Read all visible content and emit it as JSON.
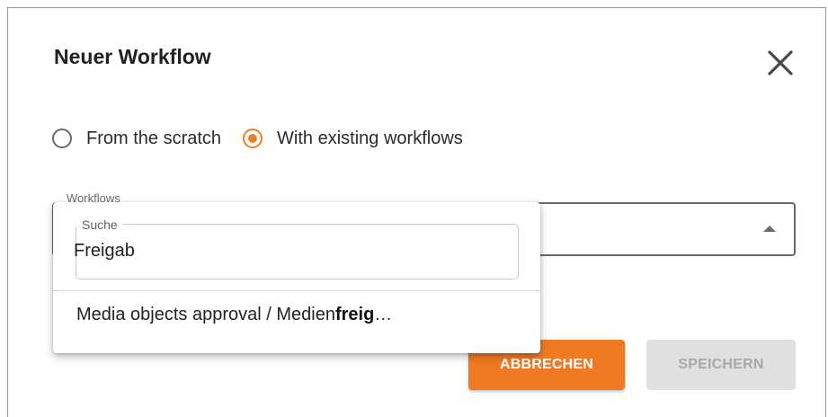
{
  "dialog": {
    "title": "Neuer Workflow",
    "close_icon": "close-icon"
  },
  "mode": {
    "options": [
      {
        "label": "From the scratch",
        "selected": false
      },
      {
        "label": "With existing workflows",
        "selected": true
      }
    ]
  },
  "workflows_field": {
    "label": "Workflows",
    "value": ""
  },
  "dropdown": {
    "search_label": "Suche",
    "search_value": "Freigab",
    "results": [
      {
        "prefix": "Media objects approval / Medien",
        "highlight": "freig",
        "suffix": "…"
      }
    ]
  },
  "buttons": {
    "cancel": "ABBRECHEN",
    "save": "SPEICHERN"
  },
  "colors": {
    "accent": "#f07a23",
    "disabled_bg": "#e0e0e0",
    "disabled_text": "#a8a8a8"
  }
}
